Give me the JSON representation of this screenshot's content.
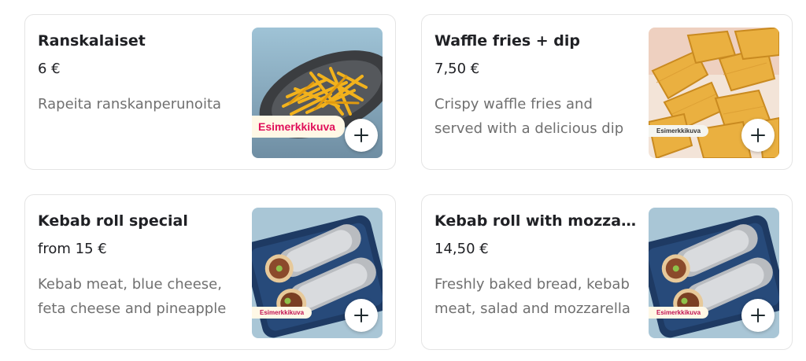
{
  "items": [
    {
      "title": "Ranskalaiset",
      "price": "6 €",
      "description": "Rapeita ranskanperunoita",
      "badge": "Esimerkkikuva",
      "image_icon": "fries-plate-image",
      "add_icon": "plus-icon"
    },
    {
      "title": "Waffle fries + dip",
      "price": "7,50 €",
      "description": "Crispy waffle fries and served with a delicious dip",
      "badge": "Esimerkkikuva",
      "image_icon": "waffle-fries-image",
      "add_icon": "plus-icon"
    },
    {
      "title": "Kebab roll special",
      "price": "from 15 €",
      "description": "Kebab meat, blue cheese, feta cheese and pineapple",
      "badge": "Esimerkkikuva",
      "image_icon": "kebab-roll-image",
      "add_icon": "plus-icon"
    },
    {
      "title": "Kebab roll with mozzarella",
      "price": "14,50 €",
      "description": "Freshly baked bread, kebab meat, salad and mozzarella",
      "badge": "Esimerkkikuva",
      "image_icon": "kebab-roll-image",
      "add_icon": "plus-icon"
    }
  ],
  "colors": {
    "badge_text": "#e0105a",
    "badge_bg": "#fff8e6",
    "add_icon": "#1f2a2e",
    "description_text": "#707070"
  }
}
